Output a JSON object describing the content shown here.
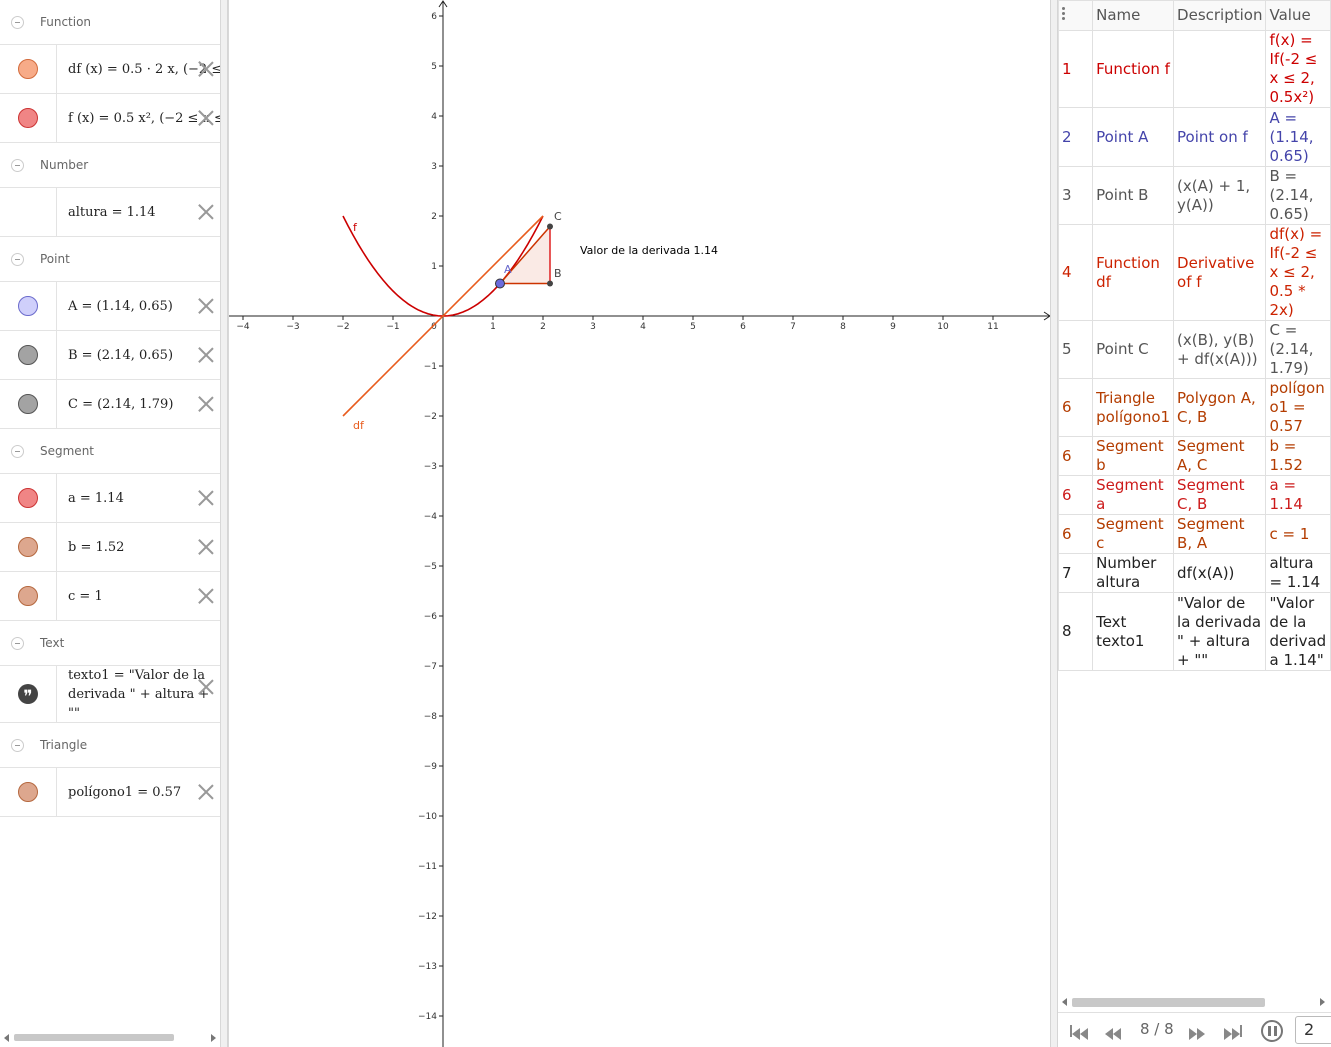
{
  "algebra": {
    "groups": {
      "function": "Function",
      "number": "Number",
      "point": "Point",
      "segment": "Segment",
      "text": "Text",
      "triangle": "Triangle"
    },
    "items": {
      "df": "df (x)  =  0.5 · 2 x,     (−2 ≤",
      "f": "f (x)  =  0.5 x²,     (−2 ≤ x ≤",
      "altura": "altura = 1.14",
      "A": "A = (1.14, 0.65)",
      "B": "B = (2.14, 0.65)",
      "C": "C = (2.14, 1.79)",
      "a": "a = 1.14",
      "b": "b = 1.52",
      "c": "c = 1",
      "texto1_line1": "texto1 = \"Valor de la",
      "texto1_line2": "derivada \" + altura + \"\"",
      "poligono1": "polígono1 = 0.57"
    },
    "quote_glyph": "❞"
  },
  "colors": {
    "f": "#cc0000",
    "df": "#e85c1e",
    "pointA": "#6666cc",
    "gray": "#444444",
    "triangle": "#cc3300",
    "marble_orange": "#f2a27f",
    "marble_red": "#ef7777",
    "marble_blue": "#c9c9f9",
    "marble_gray": "#9e9e9e",
    "marble_tan": "#d9a38a"
  },
  "graphics": {
    "label_f": "f",
    "label_df": "df",
    "label_A": "A",
    "label_B": "B",
    "label_C": "C",
    "text": "Valor de la derivada  1.14",
    "x_ticks": [
      "−4",
      "−3",
      "−2",
      "−1",
      "0",
      "1",
      "2",
      "3",
      "4",
      "5",
      "6",
      "7",
      "8",
      "9",
      "10",
      "11"
    ],
    "y_ticks": [
      "6",
      "5",
      "4",
      "3",
      "2",
      "1",
      "−1",
      "−2",
      "−3",
      "−4",
      "−5",
      "−6",
      "−7",
      "−8",
      "−9",
      "−10",
      "−11",
      "−12",
      "−13",
      "−14"
    ]
  },
  "protocol": {
    "headers": {
      "name": "Name",
      "description": "Description",
      "value": "Value"
    },
    "rows": [
      {
        "no": "1",
        "name": "Function f",
        "desc": "",
        "value": "f(x) = If(-2 ≤ x ≤ 2, 0.5x²)",
        "color": "#cc0000"
      },
      {
        "no": "2",
        "name": "Point A",
        "desc": "Point on f",
        "value": "A = (1.14, 0.65)",
        "color": "#4444aa"
      },
      {
        "no": "3",
        "name": "Point B",
        "desc": "(x(A) + 1, y(A))",
        "value": "B = (2.14, 0.65)",
        "color": "#555555"
      },
      {
        "no": "4",
        "name": "Function df",
        "desc": "Derivative of f",
        "value": "df(x) = If(-2 ≤ x ≤ 2, 0.5 * 2x)",
        "color": "#cc2200"
      },
      {
        "no": "5",
        "name": "Point C",
        "desc": "(x(B), y(B) + df(x(A)))",
        "value": "C = (2.14, 1.79)",
        "color": "#555555"
      },
      {
        "no": "6",
        "name": "Triangle polígono1",
        "desc": "Polygon A, C, B",
        "value": "polígono1 = 0.57",
        "color": "#b33c00"
      },
      {
        "no": "6",
        "name": "Segment b",
        "desc": "Segment A, C",
        "value": "b = 1.52",
        "color": "#b33c00"
      },
      {
        "no": "6",
        "name": "Segment a",
        "desc": "Segment C, B",
        "value": "a = 1.14",
        "color": "#cc1a1a"
      },
      {
        "no": "6",
        "name": "Segment c",
        "desc": "Segment B, A",
        "value": "c = 1",
        "color": "#b33c00"
      },
      {
        "no": "7",
        "name": "Number altura",
        "desc": "df(x(A))",
        "value": "altura = 1.14",
        "color": "#222222"
      },
      {
        "no": "8",
        "name": "Text texto1",
        "desc": "\"Valor de la derivada \" + altura + \"\"",
        "value": "\"Valor de la derivada 1.14\"",
        "color": "#222222"
      }
    ],
    "nav": {
      "counter": "8 / 8",
      "speed": "2"
    }
  }
}
